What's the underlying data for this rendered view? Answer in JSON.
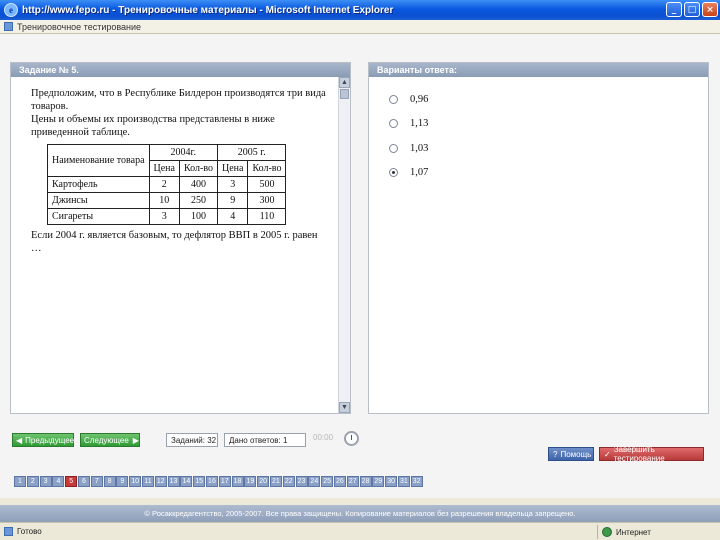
{
  "window": {
    "title": "http://www.fepo.ru - Тренировочные материалы - Microsoft Internet Explorer",
    "controls": [
      "_",
      "□",
      "×"
    ]
  },
  "linkbar": {
    "text": "Тренировочное тестирование"
  },
  "question_panel": {
    "header": "Задание № 5.",
    "text_intro": "Предположим, что в Республике Билдерон производятся три вида товаров.",
    "text_intro2": "Цены и объемы их производства представлены в ниже приведенной таблице.",
    "table": {
      "h_name": "Наименование товара",
      "h_2004": "2004г.",
      "h_2005": "2005 г.",
      "h_price": "Цена",
      "h_qty": "Кол-во",
      "rows": [
        {
          "name": "Картофель",
          "p04": "2",
          "q04": "400",
          "p05": "3",
          "q05": "500"
        },
        {
          "name": "Джинсы",
          "p04": "10",
          "q04": "250",
          "p05": "9",
          "q05": "300"
        },
        {
          "name": "Сигареты",
          "p04": "3",
          "q04": "100",
          "p05": "4",
          "q05": "110"
        }
      ]
    },
    "text_outro": "Если 2004 г. является базовым, то дефлятор ВВП в 2005 г. равен …"
  },
  "answer_panel": {
    "header": "Варианты ответа:",
    "options": [
      {
        "label": "0,96",
        "checked": false
      },
      {
        "label": "1,13",
        "checked": false
      },
      {
        "label": "1,03",
        "checked": false
      },
      {
        "label": "1,07",
        "checked": true
      }
    ]
  },
  "controls": {
    "prev_label": "Предыдущее",
    "next_label": "Следующее",
    "tasks_label": "Заданий: 32",
    "answered_label": "Дано ответов: 1",
    "timer": "00:00",
    "help_label": "Помощь",
    "finish_label": "Завершить тестирование"
  },
  "question_numbers": {
    "items": [
      "1",
      "2",
      "3",
      "4",
      "5",
      "6",
      "7",
      "8",
      "9",
      "10",
      "11",
      "12",
      "13",
      "14",
      "15",
      "16",
      "17",
      "18",
      "19",
      "20",
      "21",
      "22",
      "23",
      "24",
      "25",
      "26",
      "27",
      "28",
      "29",
      "30",
      "31",
      "32"
    ],
    "current": "5"
  },
  "footer": {
    "text": "© Росаккредагентство, 2005-2007. Все права защищены. Копирование материалов без разрешения владельца запрещено."
  },
  "statusbar": {
    "left": "Готово",
    "zone": "Интернет"
  }
}
